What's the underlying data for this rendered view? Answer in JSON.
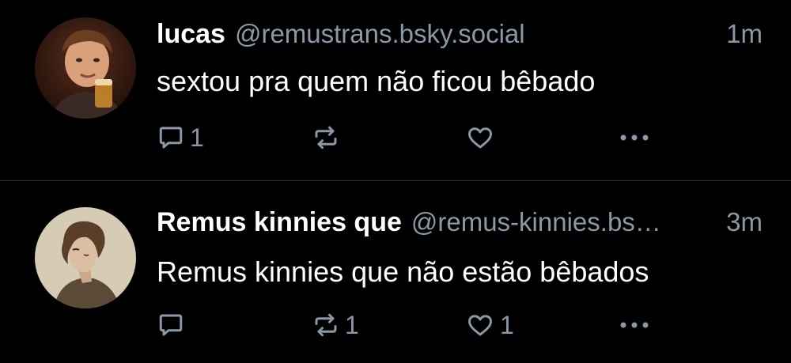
{
  "posts": [
    {
      "display_name": "lucas",
      "handle": "@remustrans.bsky.social",
      "time": "1m",
      "text": "sextou pra quem não ficou bêbado",
      "reply_count": "1",
      "repost_count": "",
      "like_count": ""
    },
    {
      "display_name": "Remus kinnies que",
      "handle": "@remus-kinnies.bsky.social",
      "time": "3m",
      "text": "Remus kinnies que não estão bêbados",
      "reply_count": "",
      "repost_count": "1",
      "like_count": "1"
    }
  ],
  "icons": {
    "reply": "reply-icon",
    "repost": "repost-icon",
    "like": "heart-icon",
    "more": "more-options-icon"
  },
  "colors": {
    "background": "#000000",
    "text_primary": "#ffffff",
    "text_secondary": "#8b98a5",
    "divider": "#2a2f36"
  }
}
